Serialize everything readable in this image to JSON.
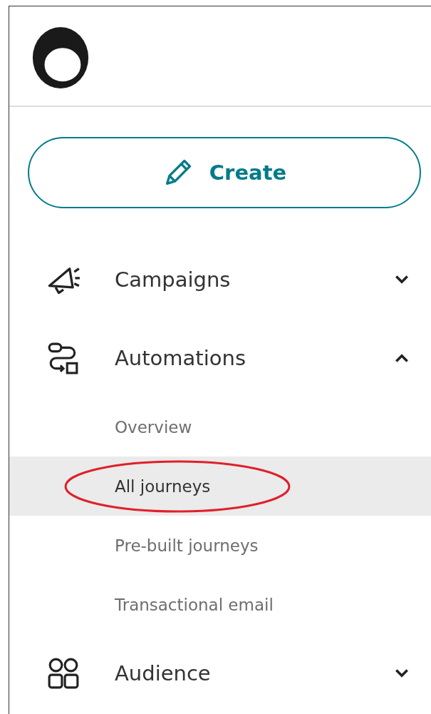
{
  "create_button": {
    "label": "Create"
  },
  "nav": [
    {
      "label": "Campaigns",
      "expanded": false
    },
    {
      "label": "Automations",
      "expanded": true,
      "children": [
        {
          "label": "Overview",
          "selected": false
        },
        {
          "label": "All journeys",
          "selected": true
        },
        {
          "label": "Pre-built journeys",
          "selected": false
        },
        {
          "label": "Transactional email",
          "selected": false
        }
      ]
    },
    {
      "label": "Audience",
      "expanded": false
    }
  ]
}
